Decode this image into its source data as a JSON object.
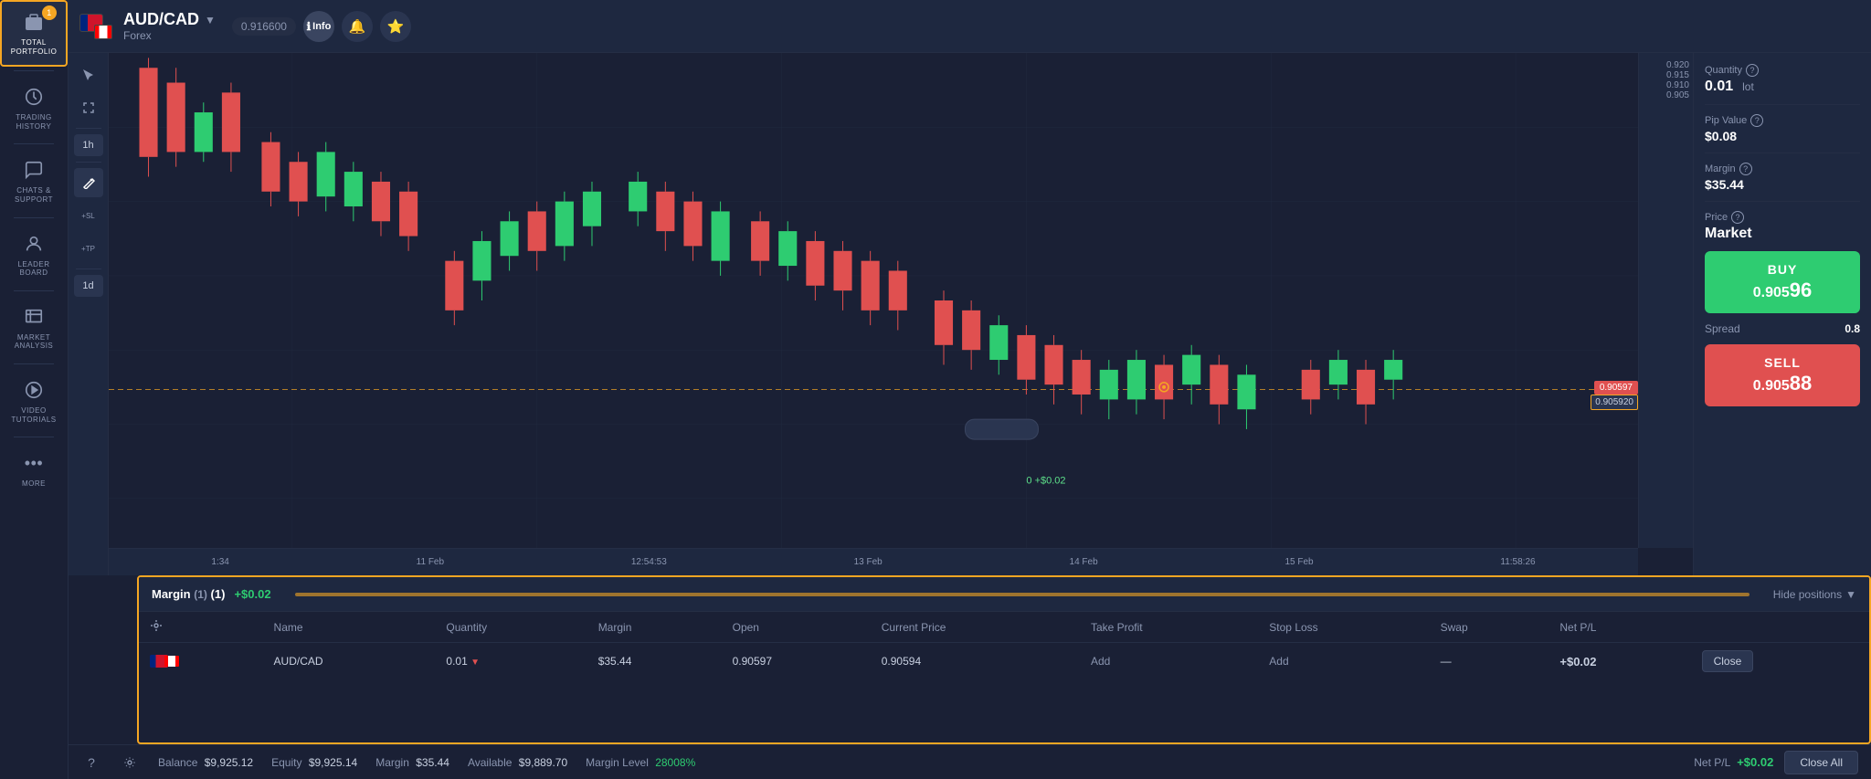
{
  "sidebar": {
    "items": [
      {
        "id": "total-portfolio",
        "label": "TOTAL\nPORTFOLIO",
        "icon": "💼",
        "badge": "1",
        "active": true
      },
      {
        "id": "trading-history",
        "label": "TRADING\nHISTORY",
        "icon": "🕐",
        "active": false
      },
      {
        "id": "chats-support",
        "label": "CHATS &\nSUPPORT",
        "icon": "💬",
        "active": false
      },
      {
        "id": "leaderboard",
        "label": "LEADER\nBOARD",
        "icon": "👤",
        "active": false
      },
      {
        "id": "market-analysis",
        "label": "MARKET\nANALYSIS",
        "icon": "📊",
        "active": false
      },
      {
        "id": "video-tutorials",
        "label": "VIDEO\nTUTORIALS",
        "icon": "▶",
        "active": false
      },
      {
        "id": "more",
        "label": "MORE",
        "icon": "•••",
        "active": false
      }
    ]
  },
  "topbar": {
    "pair": "AUD/CAD",
    "category": "Forex",
    "price_tag": "0.916600",
    "info_label": "Info",
    "chevron": "▼"
  },
  "chart": {
    "timeframes": [
      "1h",
      "1d"
    ],
    "price_levels": [
      "0.920",
      "0.915",
      "0.910",
      "0.905"
    ],
    "time_labels": [
      "1:34",
      "11 Feb",
      "12:54:53",
      "13 Feb",
      "14 Feb",
      "15 Feb",
      "11:58:26"
    ],
    "current_price": "0.905920",
    "entry_price": "0.90597",
    "profit_label": "0  +$0.02",
    "dashed_price": "0.90597"
  },
  "right_panel": {
    "quantity_label": "Quantity",
    "quantity_value": "0.01",
    "quantity_unit": "lot",
    "pip_label": "Pip Value",
    "pip_value": "$0.08",
    "margin_label": "Margin",
    "margin_value": "$35.44",
    "price_label": "Price",
    "price_value": "Market",
    "buy_label": "BUY",
    "buy_price_main": "0.905",
    "buy_price_highlight": "96",
    "sell_label": "SELL",
    "sell_price_main": "0.905",
    "sell_price_highlight": "88",
    "spread_label": "Spread",
    "spread_value": "0.8"
  },
  "positions": {
    "margin_label": "Margin",
    "margin_count": "(1)",
    "margin_profit": "+$0.02",
    "hide_btn": "Hide positions",
    "columns": [
      "Name",
      "Quantity",
      "Margin",
      "Open",
      "Current Price",
      "Take Profit",
      "Stop Loss",
      "Swap",
      "Net P/L",
      ""
    ],
    "rows": [
      {
        "flag": "🇦🇺🇨🇦",
        "name": "AUD/CAD",
        "quantity": "0.01",
        "direction": "▼",
        "margin": "$35.44",
        "open": "0.90597",
        "current_price": "0.90594",
        "take_profit": "Add",
        "stop_loss": "Add",
        "swap": "—",
        "net_pl": "+$0.02",
        "close_label": "Close"
      }
    ]
  },
  "footer": {
    "balance_label": "Balance",
    "balance_value": "$9,925.12",
    "equity_label": "Equity",
    "equity_value": "$9,925.14",
    "margin_label": "Margin",
    "margin_value": "$35.44",
    "available_label": "Available",
    "available_value": "$9,889.70",
    "margin_level_label": "Margin Level",
    "margin_level_value": "28008%",
    "net_pl_label": "Net P/L",
    "net_pl_value": "+$0.02",
    "close_all_label": "Close All"
  }
}
